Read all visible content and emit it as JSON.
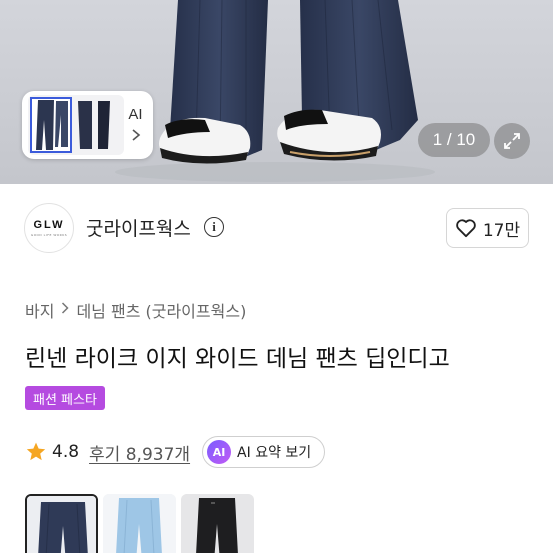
{
  "gallery": {
    "ai_label": "AI",
    "counter": "1 / 10"
  },
  "store": {
    "logo_text": "GLW",
    "logo_sub": "GOOD LIFE WORKS",
    "name": "굿라이프웍스",
    "likes": "17만"
  },
  "breadcrumb": [
    "바지",
    "데님 팬츠 (굿라이프웍스)"
  ],
  "product": {
    "title": "린넨 라이크 이지 와이드 데님 팬츠 딥인디고",
    "promo_badge": "패션 페스타",
    "rating": "4.8",
    "reviews": "후기 8,937개",
    "ai_summary_badge": "AI",
    "ai_summary_label": "AI 요약 보기"
  },
  "colors": {
    "promo": "#b54be0",
    "star": "#f5a623",
    "denim_dark": "#2f3a57",
    "denim_light": "#9ec6e6",
    "black_pants": "#1e1e20"
  },
  "variants": [
    {
      "name": "deep indigo",
      "selected": true
    },
    {
      "name": "light blue",
      "selected": false
    },
    {
      "name": "black",
      "selected": false
    }
  ]
}
